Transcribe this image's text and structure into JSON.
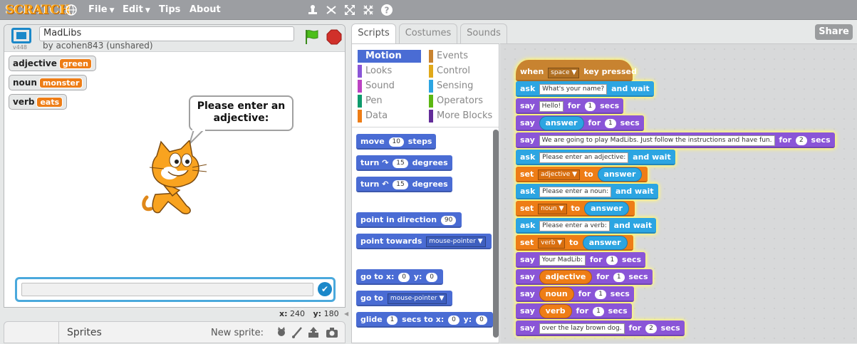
{
  "menubar": {
    "logo": "SCRATCH",
    "file": "File",
    "edit": "Edit",
    "tips": "Tips",
    "about": "About"
  },
  "stage": {
    "project_title": "MadLibs",
    "byline": "by acohen843 (unshared)",
    "version": "v448",
    "speech_bubble": "Please enter an adjective:",
    "monitors": [
      {
        "name": "adjective",
        "value": "green"
      },
      {
        "name": "noun",
        "value": "monster"
      },
      {
        "name": "verb",
        "value": "eats"
      }
    ],
    "coords": {
      "x_label": "x:",
      "x": "240",
      "y_label": "y:",
      "y": "180"
    }
  },
  "sprites_panel": {
    "title": "Sprites",
    "new_sprite": "New sprite:"
  },
  "tabs": [
    "Scripts",
    "Costumes",
    "Sounds"
  ],
  "share": "Share",
  "categories_left": [
    "Motion",
    "Looks",
    "Sound",
    "Pen",
    "Data"
  ],
  "categories_right": [
    "Events",
    "Control",
    "Sensing",
    "Operators",
    "More Blocks"
  ],
  "category_colors": {
    "Motion": "#4a6cd4",
    "Looks": "#8a55d7",
    "Sound": "#bb42c3",
    "Pen": "#0e9a6c",
    "Data": "#ee7d16",
    "Events": "#c88330",
    "Control": "#e1a91a",
    "Sensing": "#2ca5e2",
    "Operators": "#5cb712",
    "More Blocks": "#632d99"
  },
  "palette_blocks": {
    "move": {
      "a": "move",
      "n": "10",
      "b": "steps"
    },
    "turn_right": {
      "a": "turn",
      "n": "15",
      "b": "degrees"
    },
    "turn_left": {
      "a": "turn",
      "n": "15",
      "b": "degrees"
    },
    "point_dir": {
      "a": "point in direction",
      "n": "90"
    },
    "point_towards": {
      "a": "point towards",
      "dd": "mouse-pointer"
    },
    "goto_xy": {
      "a": "go to x:",
      "x": "0",
      "b": "y:",
      "y": "0"
    },
    "goto": {
      "a": "go to",
      "dd": "mouse-pointer"
    },
    "glide": {
      "a": "glide",
      "n": "1",
      "b": "secs to x:",
      "x": "0",
      "c": "y:",
      "y": "0"
    }
  },
  "script": {
    "hat": {
      "a": "when",
      "key": "space",
      "b": "key pressed"
    },
    "blocks": [
      {
        "t": "sensing",
        "a": "ask",
        "s": "What's your name?",
        "b": "and wait"
      },
      {
        "t": "looks",
        "a": "say",
        "s": "Hello!",
        "b": "for",
        "n": "1",
        "c": "secs"
      },
      {
        "t": "looks",
        "a": "say",
        "r": "answer",
        "rt": "sensing",
        "b": "for",
        "n": "1",
        "c": "secs"
      },
      {
        "t": "looks",
        "a": "say",
        "s": "We are going to play MadLibs. Just follow the instructions and have fun.",
        "b": "for",
        "n": "2",
        "c": "secs"
      },
      {
        "t": "sensing",
        "a": "ask",
        "s": "Please enter an adjective:",
        "b": "and wait"
      },
      {
        "t": "data",
        "a": "set",
        "dd": "adjective",
        "b": "to",
        "r": "answer",
        "rt": "sensing"
      },
      {
        "t": "sensing",
        "a": "ask",
        "s": "Please enter a noun:",
        "b": "and wait"
      },
      {
        "t": "data",
        "a": "set",
        "dd": "noun",
        "b": "to",
        "r": "answer",
        "rt": "sensing"
      },
      {
        "t": "sensing",
        "a": "ask",
        "s": "Please enter a verb:",
        "b": "and wait"
      },
      {
        "t": "data",
        "a": "set",
        "dd": "verb",
        "b": "to",
        "r": "answer",
        "rt": "sensing"
      },
      {
        "t": "looks",
        "a": "say",
        "s": "Your MadLib:",
        "b": "for",
        "n": "1",
        "c": "secs"
      },
      {
        "t": "looks",
        "a": "say",
        "r": "adjective",
        "rt": "data",
        "b": "for",
        "n": "1",
        "c": "secs"
      },
      {
        "t": "looks",
        "a": "say",
        "r": "noun",
        "rt": "data",
        "b": "for",
        "n": "1",
        "c": "secs"
      },
      {
        "t": "looks",
        "a": "say",
        "r": "verb",
        "rt": "data",
        "b": "for",
        "n": "1",
        "c": "secs"
      },
      {
        "t": "looks",
        "a": "say",
        "s": "over the lazy brown dog.",
        "b": "for",
        "n": "2",
        "c": "secs"
      }
    ]
  }
}
